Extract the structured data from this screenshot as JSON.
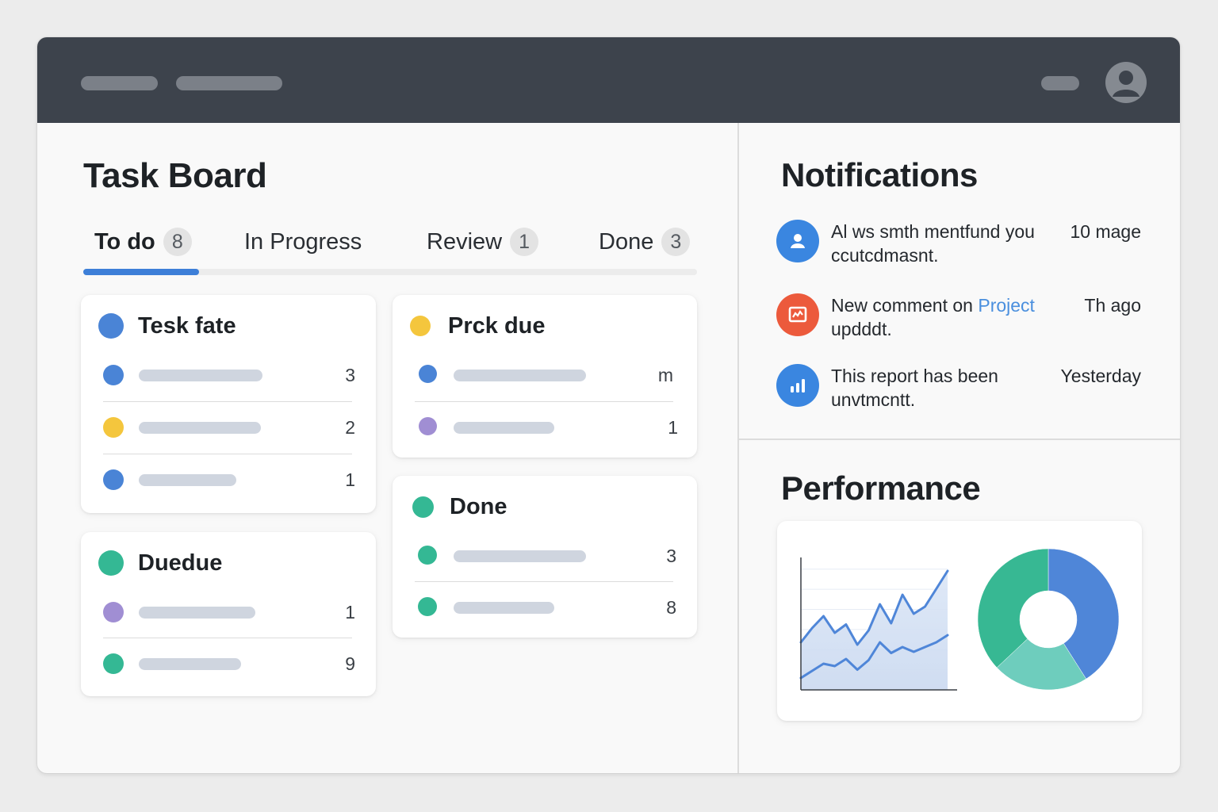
{
  "board": {
    "title": "Task Board",
    "tabs": [
      {
        "label": "To do",
        "count": "8",
        "active": true
      },
      {
        "label": "In Progress",
        "count": "",
        "active": false
      },
      {
        "label": "Review",
        "count": "1",
        "active": false
      },
      {
        "label": "Done",
        "count": "3",
        "active": false
      }
    ],
    "cards": [
      {
        "title": "Tesk fate",
        "dot_color": "#4a84d6",
        "rows": [
          {
            "dot_color": "#4a84d6",
            "count": "3"
          },
          {
            "dot_color": "#f4c63d",
            "count": "2"
          },
          {
            "dot_color": "#4a84d6",
            "count": "1"
          }
        ]
      },
      {
        "title": "Duedue",
        "dot_color": "#34b894",
        "rows": [
          {
            "dot_color": "#a08ed3",
            "count": "1"
          },
          {
            "dot_color": "#34b894",
            "count": "9"
          }
        ]
      },
      {
        "title": "Prck due",
        "dot_color": "#f4c63d",
        "rows": [
          {
            "dot_color": "#4a84d6",
            "count": "m"
          },
          {
            "dot_color": "#a08ed3",
            "count": "1"
          }
        ]
      },
      {
        "title": "Done",
        "dot_color": "#34b894",
        "rows": [
          {
            "dot_color": "#34b894",
            "count": "3"
          },
          {
            "dot_color": "#34b894",
            "count": "8"
          }
        ]
      }
    ]
  },
  "notifications": {
    "title": "Notifications",
    "items": [
      {
        "icon": "user-icon",
        "icon_color": "#3a86e0",
        "text": "Al ws smth mentfund you ccutcdmasnt.",
        "link": "",
        "text_after": "",
        "time": "10 mage"
      },
      {
        "icon": "comment-icon",
        "icon_color": "#ec5a3c",
        "text": "New comment on ",
        "link": "Project",
        "text_after": " updddt.",
        "time": "Th ago"
      },
      {
        "icon": "bar-chart-icon",
        "icon_color": "#3a86e0",
        "text": "This report has been unvtmcntt.",
        "link": "",
        "text_after": "",
        "time": "Yesterday"
      }
    ]
  },
  "performance": {
    "title": "Performance"
  },
  "colors": {
    "topbar": "#3d434c",
    "accent": "#3d7fd8",
    "chart_blue": "#4f86d8",
    "chart_green": "#37b893",
    "chart_teal": "#6ecdbd"
  },
  "chart_data": [
    {
      "type": "line",
      "x": [
        0,
        1,
        2,
        3,
        4,
        5,
        6,
        7,
        8,
        9,
        10,
        11,
        12,
        13
      ],
      "series": [
        {
          "values": [
            40,
            52,
            62,
            48,
            55,
            38,
            50,
            72,
            56,
            80,
            64,
            70,
            85,
            100
          ]
        },
        {
          "values": [
            10,
            16,
            22,
            20,
            26,
            17,
            25,
            40,
            31,
            36,
            32,
            36,
            40,
            46
          ]
        }
      ],
      "ylim": [
        0,
        110
      ],
      "grid": true
    },
    {
      "type": "pie",
      "donut": true,
      "slices": [
        {
          "value": 41,
          "color": "#4f86d8"
        },
        {
          "value": 22,
          "color": "#6ecdbd"
        },
        {
          "value": 37,
          "color": "#37b893"
        }
      ]
    }
  ]
}
